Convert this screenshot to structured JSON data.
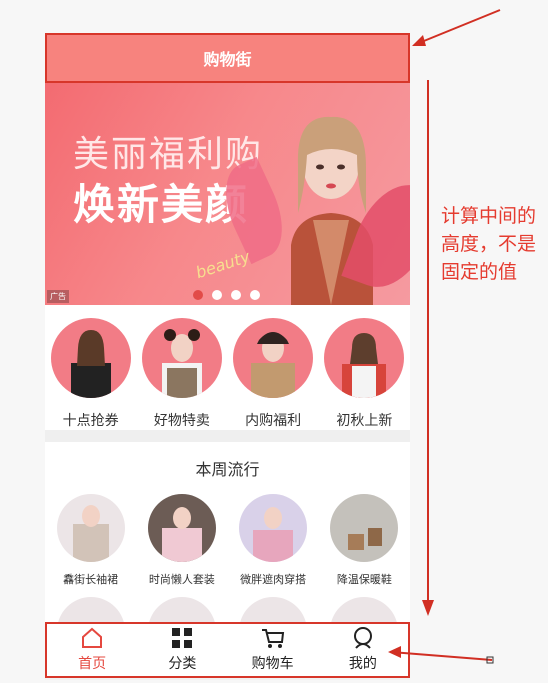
{
  "header": {
    "title": "购物街"
  },
  "banner": {
    "line1": "美丽福利购",
    "line2": "焕新美颜",
    "script": "beauty",
    "ad": "广告",
    "dots": [
      true,
      false,
      false,
      false
    ]
  },
  "categories": [
    {
      "label": "十点抢券"
    },
    {
      "label": "好物特卖"
    },
    {
      "label": "内购福利"
    },
    {
      "label": "初秋上新"
    }
  ],
  "weekly": {
    "title": "本周流行",
    "items": [
      {
        "label": "馫街长袖裙"
      },
      {
        "label": "时尚懒人套装"
      },
      {
        "label": "微胖遮肉穿搭"
      },
      {
        "label": "降温保暖鞋"
      }
    ]
  },
  "tabbar": {
    "tabs": [
      {
        "label": "首页",
        "active": true
      },
      {
        "label": "分类",
        "active": false
      },
      {
        "label": "购物车",
        "active": false
      },
      {
        "label": "我的",
        "active": false
      }
    ]
  },
  "annotation": {
    "text": "计算中间的高度，不是固定的值"
  },
  "colors": {
    "header_bg": "#f7837e",
    "annotation": "#e53b2f",
    "active_tab": "#e5483f"
  }
}
